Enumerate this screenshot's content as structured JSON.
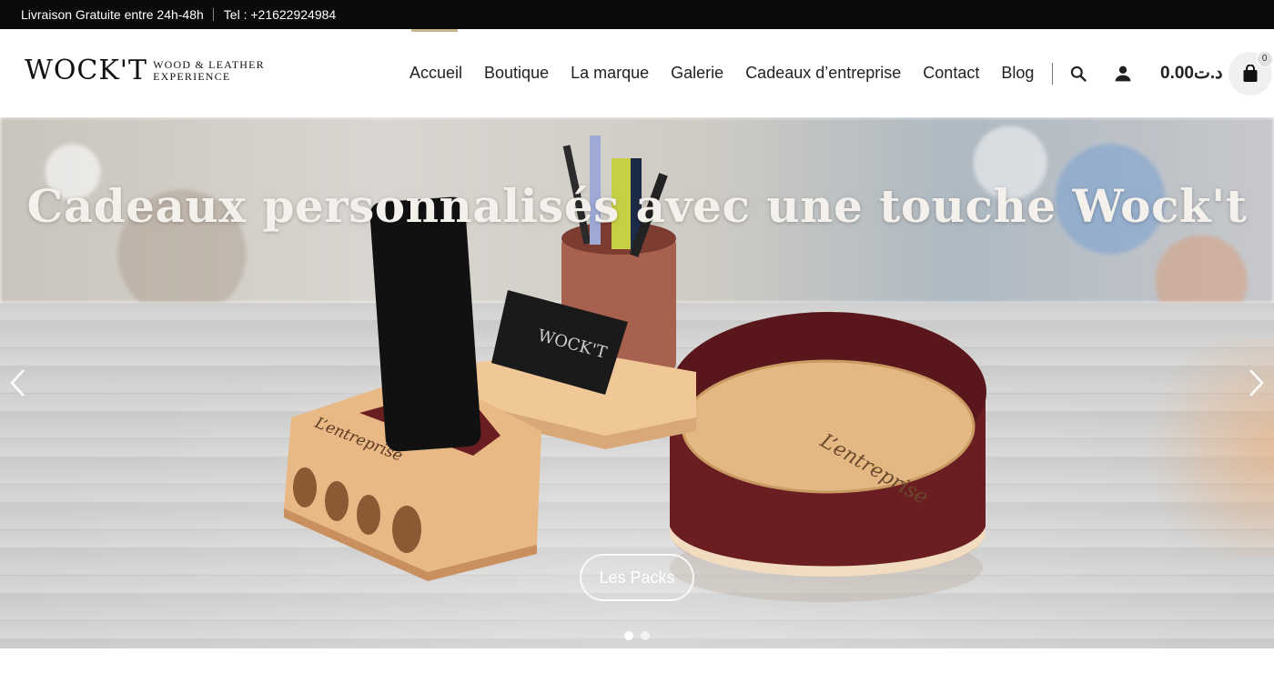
{
  "topbar": {
    "delivery": "Livraison Gratuite entre 24h-48h",
    "phone": "Tel : +21622924984"
  },
  "logo": {
    "main": "WOCK'T",
    "tagline_line1": "WOOD & LEATHER",
    "tagline_line2": "EXPERIENCE"
  },
  "nav": {
    "items": [
      {
        "label": "Accueil"
      },
      {
        "label": "Boutique"
      },
      {
        "label": "La marque"
      },
      {
        "label": "Galerie"
      },
      {
        "label": "Cadeaux d’entreprise"
      },
      {
        "label": "Contact"
      },
      {
        "label": "Blog"
      }
    ],
    "active_index": 0
  },
  "header_icons": {
    "search": "search-icon",
    "account": "user-icon",
    "cart": "shopping-bag-icon"
  },
  "cart": {
    "total": "0.00د.ت",
    "count": "0"
  },
  "hero": {
    "title": "Cadeaux personnalisés avec une touche Wock't",
    "cta_label": "Les Packs",
    "slide_count": 2,
    "active_slide": 0,
    "product_engraving": "L’entreprise",
    "card_text": "WOCK'T"
  },
  "colors": {
    "topbar_bg": "#0b0b0b",
    "accent": "#c8b48a",
    "leather": "#6b1e22",
    "wood": "#e3b882"
  }
}
